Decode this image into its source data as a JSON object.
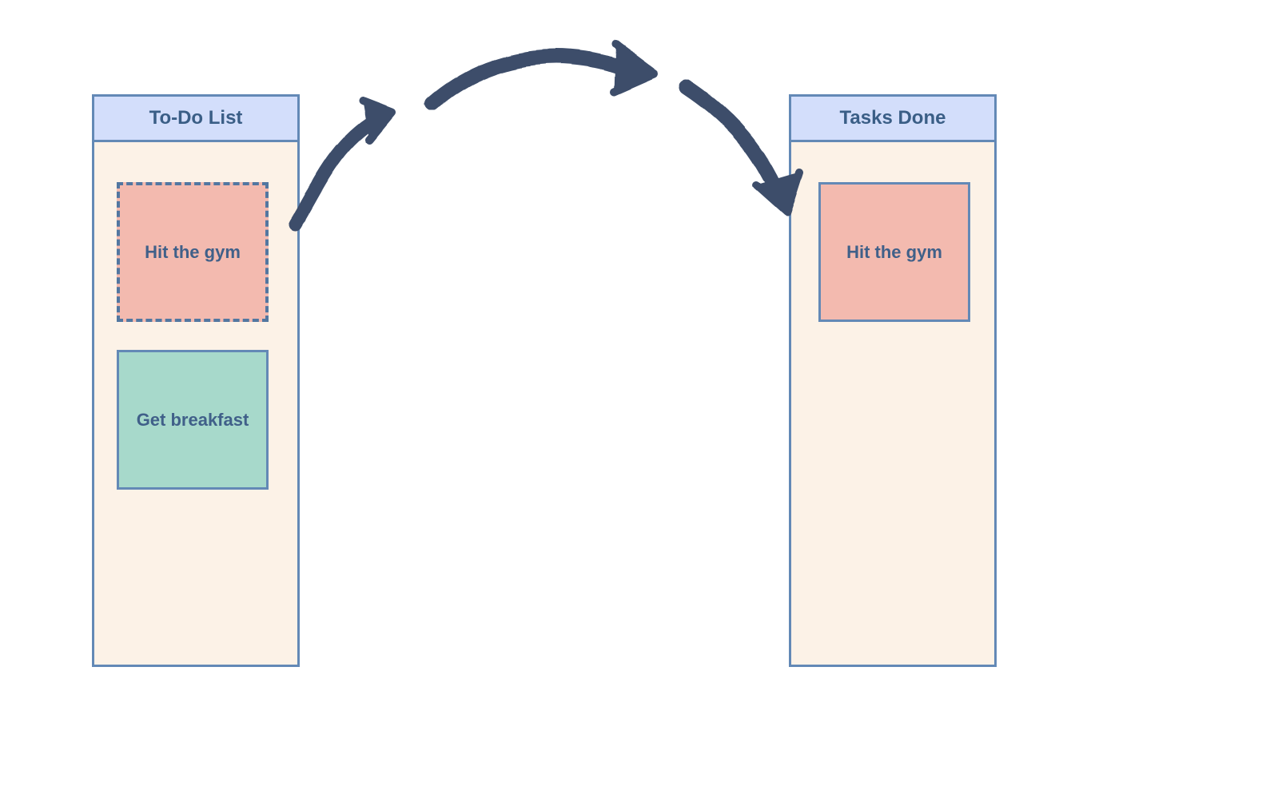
{
  "panels": {
    "todo": {
      "title": "To-Do List",
      "cards": [
        {
          "label": "Hit the gym",
          "style": "pink-dashed"
        },
        {
          "label": "Get breakfast",
          "style": "green"
        }
      ]
    },
    "done": {
      "title": "Tasks Done",
      "cards": [
        {
          "label": "Hit the gym",
          "style": "pink-solid"
        }
      ]
    }
  },
  "colors": {
    "panel_border": "#6389b6",
    "panel_bg": "#fcf2e7",
    "header_bg": "#d3defb",
    "text": "#3a5e86",
    "arrow": "#3d4e6b",
    "card_pink": "#f3baaf",
    "card_green": "#a7d9cb"
  }
}
